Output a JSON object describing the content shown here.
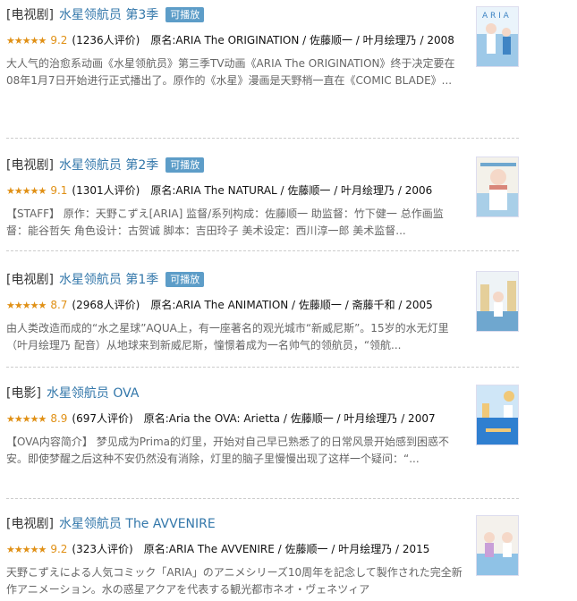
{
  "results": [
    {
      "category": "[电视剧]",
      "title": "水星领航员 第3季",
      "badge": "可播放",
      "stars": "★★★★★",
      "rating": "9.2",
      "votes": "(1236人评价)",
      "info": "原名:ARIA The ORIGINATION / 佐藤顺一 / 叶月绘理乃 / 2008",
      "desc": "大人气的治愈系动画《水星领航员》第三季TV动画《ARIA The ORIGINATION》终于决定要在08年1月7日开始进行正式播出了。原作的《水星》漫画是天野梢一直在《COMIC BLADE》...",
      "poster_colors": [
        "#eaf4fb",
        "#9ec9e8",
        "#3f84c4"
      ]
    },
    {
      "category": "[电视剧]",
      "title": "水星领航员 第2季",
      "badge": "可播放",
      "stars": "★★★★★",
      "rating": "9.1",
      "votes": "(1301人评价)",
      "info": "原名:ARIA The NATURAL / 佐藤顺一 / 叶月绘理乃 / 2006",
      "desc": "【STAFF】 原作：天野こずえ[ARIA] 监督/系列构成：佐藤顺一 助监督：竹下健一 总作画监督：能谷哲矢 角色设计：古贺诚 脚本：吉田玲子 美术设定：西川淳一郎 美术监督...",
      "poster_colors": [
        "#f3f1ea",
        "#a9cfe8",
        "#d9867a"
      ]
    },
    {
      "category": "[电视剧]",
      "title": "水星领航员 第1季",
      "badge": "可播放",
      "stars": "★★★★★",
      "rating": "8.7",
      "votes": "(2968人评价)",
      "info": "原名:ARIA The ANIMATION / 佐藤顺一 / 斋藤千和 / 2005",
      "desc": "由人类改造而成的“水之星球”AQUA上，有一座著名的观光城市“新威尼斯”。15岁的水无灯里（叶月绘理乃 配音）从地球来到新威尼斯，憧憬着成为一名帅气的领航员，“领航...",
      "poster_colors": [
        "#eef3f6",
        "#6fa7cf",
        "#e5cf9a"
      ]
    },
    {
      "category": "[电影]",
      "title": "水星领航员 OVA",
      "badge": "",
      "stars": "★★★★★",
      "rating": "8.9",
      "votes": "(697人评价)",
      "info": "原名:Aria the OVA: Arietta / 佐藤顺一 / 叶月绘理乃 / 2007",
      "desc": "【OVA内容简介】 梦见成为Prima的灯里，开始对自己早已熟悉了的日常风景开始感到困惑不安。即使梦醒之后这种不安仍然没有消除，灯里的脑子里慢慢出现了这样一个疑问：“...",
      "poster_colors": [
        "#cfe6f7",
        "#2f7fd0",
        "#f0c878"
      ]
    },
    {
      "category": "[电视剧]",
      "title": "水星领航员 The AVVENIRE",
      "badge": "",
      "stars": "★★★★★",
      "rating": "9.2",
      "votes": "(323人评价)",
      "info": "原名:ARIA The AVVENIRE / 佐藤顺一 / 叶月绘理乃 / 2015",
      "desc": "天野こずえによる人気コミック「ARIA」のアニメシリーズ10周年を記念して製作された完全新作アニメーション。水の惑星アクアを代表する観光都市ネオ・ヴェネツィア",
      "poster_colors": [
        "#f4f1ec",
        "#8fc2e6",
        "#c99fd8"
      ]
    }
  ]
}
